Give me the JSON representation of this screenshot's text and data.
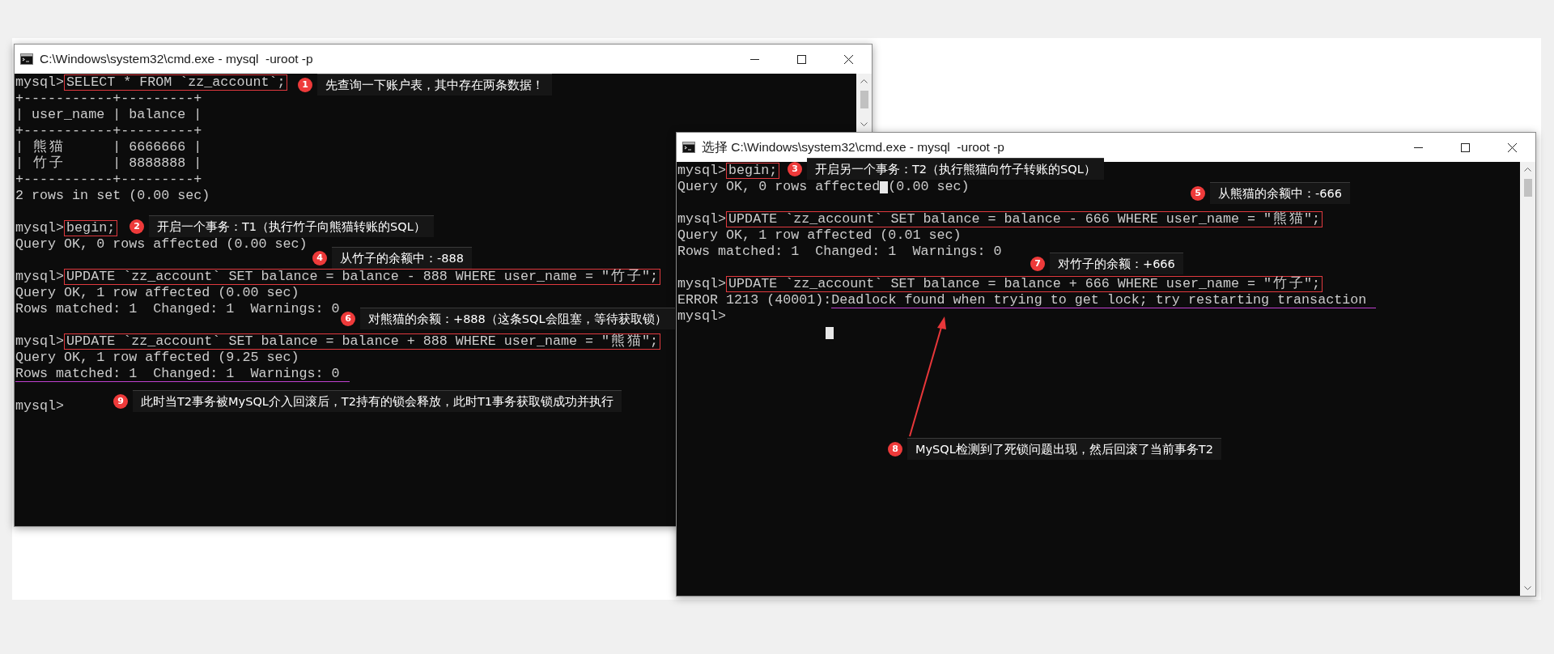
{
  "windows": [
    {
      "title": "C:\\Windows\\system32\\cmd.exe - mysql  -uroot -p",
      "lines": [
        {
          "kind": "text",
          "segments": [
            {
              "kind": "prompt",
              "text": "mysql>"
            },
            {
              "kind": "text",
              "text": "SELECT * FROM `zz_account`;",
              "boxed": true
            }
          ]
        },
        {
          "kind": "text",
          "segments": [
            {
              "kind": "text",
              "text": "+-----------+---------+"
            }
          ]
        },
        {
          "kind": "text",
          "segments": [
            {
              "kind": "text",
              "text": "| user_name | balance |"
            }
          ]
        },
        {
          "kind": "text",
          "segments": [
            {
              "kind": "text",
              "text": "+-----------+---------+"
            }
          ]
        },
        {
          "kind": "text",
          "segments": [
            {
              "kind": "text",
              "text": "| 熊猫      | 6666666 |"
            }
          ]
        },
        {
          "kind": "text",
          "segments": [
            {
              "kind": "text",
              "text": "| 竹子      | 8888888 |"
            }
          ]
        },
        {
          "kind": "text",
          "segments": [
            {
              "kind": "text",
              "text": "+-----------+---------+"
            }
          ]
        },
        {
          "kind": "text",
          "segments": [
            {
              "kind": "text",
              "text": "2 rows in set (0.00 sec)"
            }
          ]
        },
        {
          "kind": "blank"
        },
        {
          "kind": "text",
          "segments": [
            {
              "kind": "prompt",
              "text": "mysql>"
            },
            {
              "kind": "text",
              "text": "begin;",
              "boxed": true
            }
          ]
        },
        {
          "kind": "text",
          "segments": [
            {
              "kind": "text",
              "text": "Query OK, 0 rows affected (0.00 sec)"
            }
          ]
        },
        {
          "kind": "blank"
        },
        {
          "kind": "text",
          "segments": [
            {
              "kind": "prompt",
              "text": "mysql>"
            },
            {
              "kind": "text",
              "text": "UPDATE `zz_account` SET balance = balance - 888 WHERE user_name = \"竹子\";",
              "boxed": true
            }
          ]
        },
        {
          "kind": "text",
          "segments": [
            {
              "kind": "text",
              "text": "Query OK, 1 row affected (0.00 sec)"
            }
          ]
        },
        {
          "kind": "text",
          "segments": [
            {
              "kind": "text",
              "text": "Rows matched: 1  Changed: 1  Warnings: 0"
            }
          ]
        },
        {
          "kind": "blank"
        },
        {
          "kind": "text",
          "segments": [
            {
              "kind": "prompt",
              "text": "mysql>"
            },
            {
              "kind": "text",
              "text": "UPDATE `zz_account` SET balance = balance + 888 WHERE user_name = \"熊猫\";",
              "boxed": true
            }
          ]
        },
        {
          "kind": "text",
          "segments": [
            {
              "kind": "text",
              "text": "Query OK, 1 row affected (9.25 sec)"
            }
          ]
        },
        {
          "kind": "text",
          "segments": [
            {
              "kind": "text",
              "text": "Rows matched: 1  Changed: 1  Warnings: 0",
              "underlined": true
            }
          ]
        },
        {
          "kind": "blank"
        },
        {
          "kind": "text",
          "segments": [
            {
              "kind": "prompt",
              "text": "mysql>"
            }
          ]
        }
      ]
    },
    {
      "title": "选择 C:\\Windows\\system32\\cmd.exe - mysql  -uroot -p",
      "lines": [
        {
          "kind": "text",
          "segments": [
            {
              "kind": "prompt",
              "text": "mysql>"
            },
            {
              "kind": "text",
              "text": "begin;",
              "boxed": true
            }
          ]
        },
        {
          "kind": "text",
          "segments": [
            {
              "kind": "text",
              "text": "Query OK, 0 rows affected"
            },
            {
              "kind": "cursor"
            },
            {
              "kind": "text",
              "text": "(0.00 sec)"
            }
          ]
        },
        {
          "kind": "blank"
        },
        {
          "kind": "text",
          "segments": [
            {
              "kind": "prompt",
              "text": "mysql>"
            },
            {
              "kind": "text",
              "text": "UPDATE `zz_account` SET balance = balance - 666 WHERE user_name = \"熊猫\";",
              "boxed": true
            }
          ]
        },
        {
          "kind": "text",
          "segments": [
            {
              "kind": "text",
              "text": "Query OK, 1 row affected (0.01 sec)"
            }
          ]
        },
        {
          "kind": "text",
          "segments": [
            {
              "kind": "text",
              "text": "Rows matched: 1  Changed: 1  Warnings: 0"
            }
          ]
        },
        {
          "kind": "blank"
        },
        {
          "kind": "text",
          "segments": [
            {
              "kind": "prompt",
              "text": "mysql>"
            },
            {
              "kind": "text",
              "text": "UPDATE `zz_account` SET balance = balance + 666 WHERE user_name = \"竹子\";",
              "boxed": true
            }
          ]
        },
        {
          "kind": "text",
          "segments": [
            {
              "kind": "text",
              "text": "ERROR 1213 (40001):"
            },
            {
              "kind": "text",
              "text": "Deadlock found when trying to get lock; try restarting transaction",
              "underlined": true
            }
          ]
        },
        {
          "kind": "text",
          "segments": [
            {
              "kind": "prompt",
              "text": "mysql>"
            }
          ]
        },
        {
          "kind": "cursor"
        }
      ]
    }
  ],
  "annotations": [
    {
      "number": "1",
      "text": "先查询一下账户表，其中存在两条数据！"
    },
    {
      "number": "2",
      "text": "开启一个事务：T1（执行竹子向熊猫转账的SQL）"
    },
    {
      "number": "3",
      "text": "开启另一个事务：T2（执行熊猫向竹子转账的SQL）"
    },
    {
      "number": "4",
      "text": "从竹子的余额中：-888"
    },
    {
      "number": "5",
      "text": "从熊猫的余额中：-666"
    },
    {
      "number": "6",
      "text": "对熊猫的余额：+888（这条SQL会阻塞，等待获取锁）"
    },
    {
      "number": "7",
      "text": "对竹子的余额：+666"
    },
    {
      "number": "8",
      "text": "MySQL检测到了死锁问题出现，然后回滚了当前事务T2"
    },
    {
      "number": "9",
      "text": "此时当T2事务被MySQL介入回滚后，T2持有的锁会释放，此时T1事务获取锁成功并执行"
    }
  ]
}
